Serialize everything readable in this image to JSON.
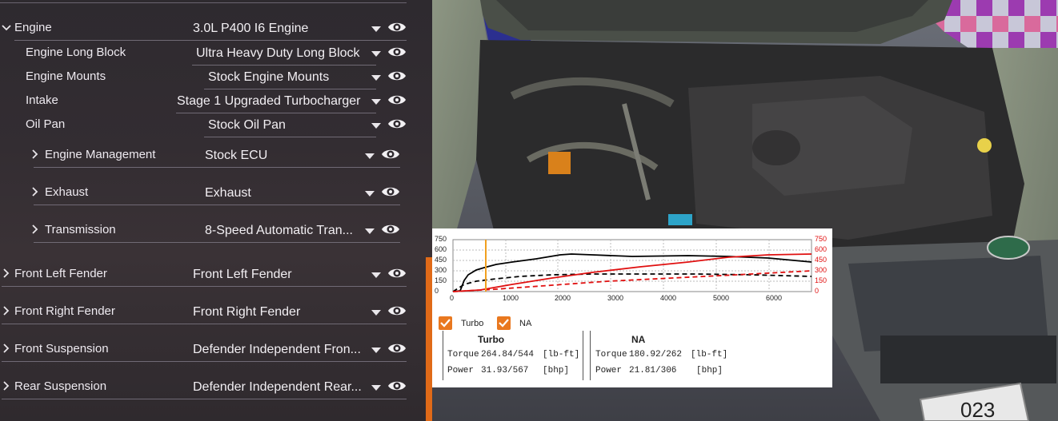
{
  "parts": {
    "rows": [
      {
        "label": "Engine",
        "value": "3.0L P400 I6 Engine"
      },
      {
        "label": "Engine Long Block",
        "value": "Ultra Heavy Duty Long Block"
      },
      {
        "label": "Engine Mounts",
        "value": "Stock Engine Mounts"
      },
      {
        "label": "Intake",
        "value": "Stage 1 Upgraded Turbocharger"
      },
      {
        "label": "Oil Pan",
        "value": "Stock Oil Pan"
      },
      {
        "label": "Engine Management",
        "value": "Stock ECU"
      },
      {
        "label": "Exhaust",
        "value": "Exhaust"
      },
      {
        "label": "Transmission",
        "value": "8-Speed Automatic Tran..."
      },
      {
        "label": "Front Left Fender",
        "value": "Front Left Fender"
      },
      {
        "label": "Front Right Fender",
        "value": "Front Right Fender"
      },
      {
        "label": "Front Suspension",
        "value": "Defender Independent Fron..."
      },
      {
        "label": "Rear Suspension",
        "value": "Defender Independent Rear..."
      }
    ]
  },
  "dyno": {
    "left_axis_ticks": [
      "750",
      "600",
      "450",
      "300",
      "150",
      "0"
    ],
    "right_axis_ticks": [
      "750",
      "600",
      "450",
      "300",
      "150",
      "0"
    ],
    "x_axis_ticks": [
      "0",
      "1000",
      "2000",
      "3000",
      "4000",
      "5000",
      "6000"
    ],
    "toggles": {
      "turbo_label": "Turbo",
      "na_label": "NA"
    },
    "turbo": {
      "heading": "Turbo",
      "torque_label": "Torque",
      "torque_value": "264.84/544",
      "torque_unit": "[lb-ft]",
      "power_label": "Power",
      "power_value": "31.93/567",
      "power_unit": "[bhp]"
    },
    "na": {
      "heading": "NA",
      "torque_label": "Torque",
      "torque_value": "180.92/262",
      "torque_unit": "[lb-ft]",
      "power_label": "Power",
      "power_value": "21.81/306",
      "power_unit": "[bhp]"
    },
    "colors": {
      "torque": "#000000",
      "power": "#e01010",
      "cursor": "#f0a020",
      "checkbox": "#e9781f"
    }
  },
  "vehicle": {
    "plate_text": "023"
  }
}
